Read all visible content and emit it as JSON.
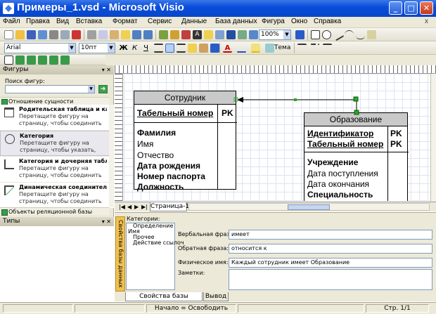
{
  "window": {
    "title": "Примеры_1.vsd - Microsoft Visio",
    "minimize": "_",
    "restore": "□",
    "close": "✕"
  },
  "menu": {
    "items": [
      "Файл",
      "Правка",
      "Вид",
      "Вставка",
      "Формат",
      "Сервис",
      "Данные",
      "База данных",
      "Фигура",
      "Окно",
      "Справка"
    ],
    "close_doc": "x"
  },
  "toolbar": {
    "zoom": "100%"
  },
  "format_toolbar": {
    "font": "Arial",
    "size": "10пт",
    "theme_label": "Тема"
  },
  "shapes_panel": {
    "title": "Фигуры",
    "search_label": "Поиск фигур:",
    "search_value": "",
    "stencil_top": "Отношение сущности",
    "items": [
      {
        "name": "Родительская таблица и кат...",
        "desc": "Перетащите фигуру на страницу, чтобы соединить родительскую ..."
      },
      {
        "name": "Категория",
        "desc": "Перетащите фигуру на страницу, чтобы указать, что одна или не..."
      },
      {
        "name": "Категория и дочерняя табли...",
        "desc": "Перетащите фигуру на страницу, чтобы соединить категорию с д..."
      },
      {
        "name": "Динамическая соединительн...",
        "desc": "Перетащите фигуру на страницу, чтобы соединить два процесса."
      }
    ],
    "stencil_bottom": "Объекты реляционной базы данных"
  },
  "types_panel": {
    "title": "Типы"
  },
  "diagram": {
    "entity1": {
      "name": "Сотрудник",
      "key": "Табельный номер",
      "key_tag": "PK",
      "attributes": [
        {
          "text": "Фамилия",
          "bold": true
        },
        {
          "text": "Имя",
          "bold": false
        },
        {
          "text": "Отчество",
          "bold": false
        },
        {
          "text": "Дата рождения",
          "bold": true
        },
        {
          "text": "Номер паспорта",
          "bold": true
        },
        {
          "text": "Должность",
          "bold": true
        }
      ]
    },
    "entity2": {
      "name": "Образование",
      "keys": [
        {
          "text": "Идентификатор",
          "tag": "PK"
        },
        {
          "text": "Табельный номер",
          "tag": "PK"
        }
      ],
      "attributes": [
        {
          "text": "Учреждение",
          "bold": true
        },
        {
          "text": "Дата поступления",
          "bold": false
        },
        {
          "text": "Дата окончания",
          "bold": false
        },
        {
          "text": "Специальность",
          "bold": true
        }
      ]
    }
  },
  "page_tabs": {
    "current": "Страница-1"
  },
  "db_properties": {
    "side_tab": "Свойства базы данных",
    "categories_label": "Категории:",
    "categories": [
      "Определение",
      "Имя",
      "Прочее",
      "Действие ссылоч"
    ],
    "verbal_label": "Вербальная фраза:",
    "verbal_value": "имеет",
    "reverse_label": "Обратная фраза:",
    "reverse_value": "относится к",
    "physical_label": "Физическое имя:",
    "physical_value": "Каждый сотрудник имеет Образование",
    "notes_label": "Заметки:",
    "notes_value": ""
  },
  "bottom_tabs": [
    "Свойства базы данных",
    "Вывод"
  ],
  "status": {
    "begin": "Начало = Освободить",
    "page": "Стр. 1/1"
  }
}
